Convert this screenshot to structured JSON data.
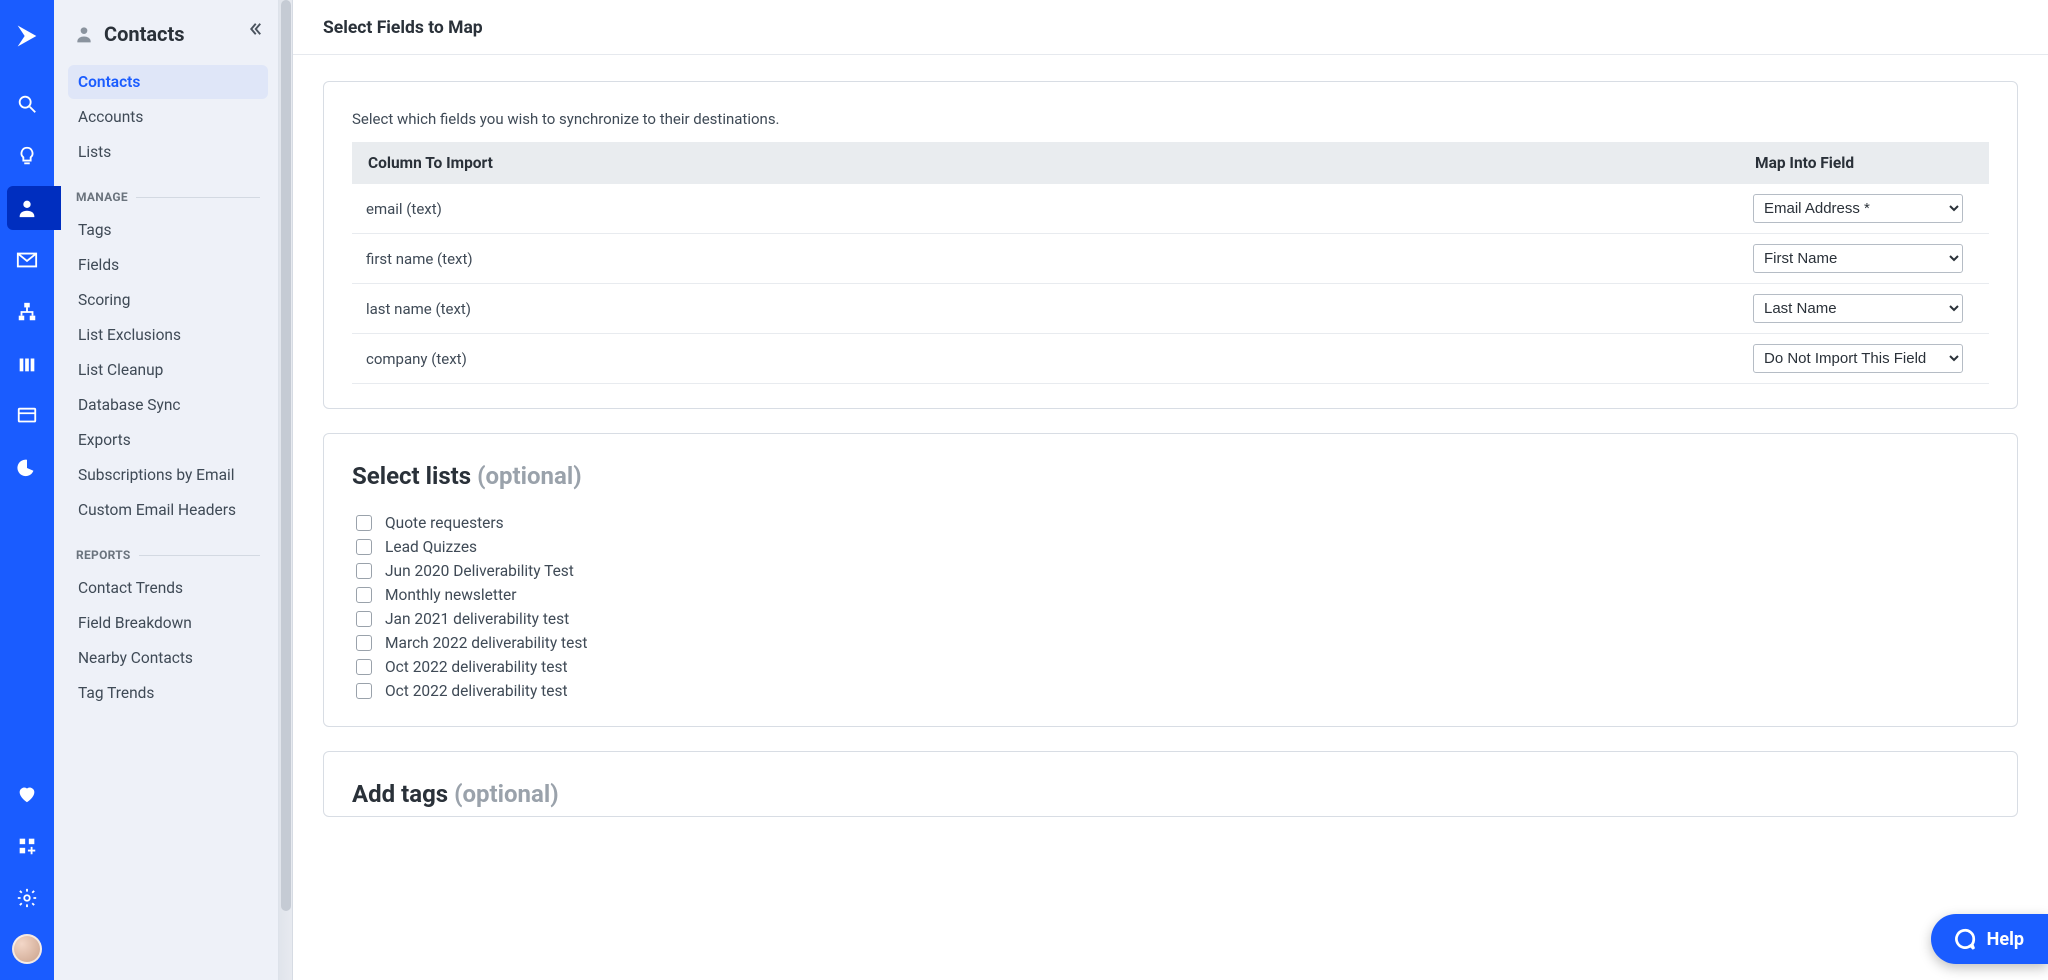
{
  "sidebar": {
    "title": "Contacts",
    "nav": [
      {
        "label": "Contacts",
        "active": true
      },
      {
        "label": "Accounts"
      },
      {
        "label": "Lists"
      }
    ],
    "sections": [
      {
        "label": "MANAGE",
        "items": [
          {
            "label": "Tags"
          },
          {
            "label": "Fields"
          },
          {
            "label": "Scoring"
          },
          {
            "label": "List Exclusions"
          },
          {
            "label": "List Cleanup"
          },
          {
            "label": "Database Sync"
          },
          {
            "label": "Exports"
          },
          {
            "label": "Subscriptions by Email"
          },
          {
            "label": "Custom Email Headers"
          }
        ]
      },
      {
        "label": "REPORTS",
        "items": [
          {
            "label": "Contact Trends"
          },
          {
            "label": "Field Breakdown"
          },
          {
            "label": "Nearby Contacts"
          },
          {
            "label": "Tag Trends"
          }
        ]
      }
    ]
  },
  "page": {
    "title": "Select Fields to Map",
    "mapping": {
      "description": "Select which fields you wish to synchronize to their destinations.",
      "header_col1": "Column To Import",
      "header_col2": "Map Into Field",
      "rows": [
        {
          "column": "email (text)",
          "selected": "Email Address *"
        },
        {
          "column": "first name (text)",
          "selected": "First Name"
        },
        {
          "column": "last name (text)",
          "selected": "Last Name"
        },
        {
          "column": "company (text)",
          "selected": "Do Not Import This Field"
        }
      ]
    },
    "lists_section": {
      "title": "Select lists",
      "optional": "(optional)",
      "items": [
        "Quote requesters",
        "Lead Quizzes",
        "Jun 2020 Deliverability Test",
        "Monthly newsletter",
        "Jan 2021 deliverability test",
        "March 2022 deliverability test",
        "Oct 2022 deliverability test",
        "Oct 2022 deliverability test"
      ]
    },
    "tags_section": {
      "title": "Add tags",
      "optional": "(optional)"
    }
  },
  "help": {
    "label": "Help"
  }
}
